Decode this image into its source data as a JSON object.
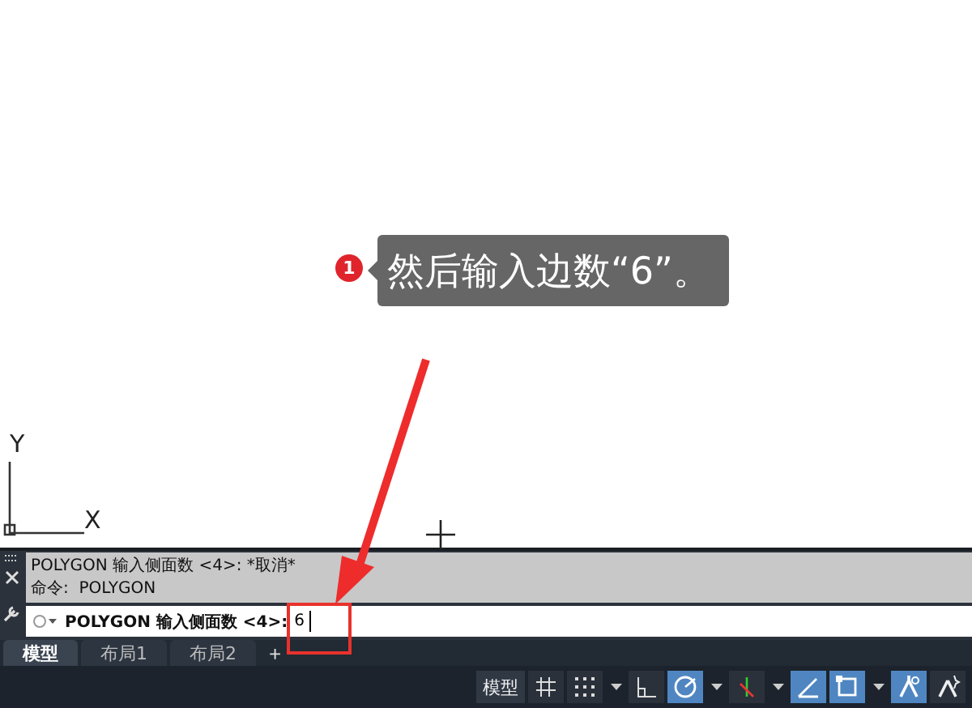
{
  "callout": {
    "badge": "1",
    "text": "然后输入边数“6”。"
  },
  "canvas": {
    "axis_y": "Y",
    "axis_x": "X"
  },
  "command": {
    "history": [
      "POLYGON 输入侧面数 <4>: *取消*",
      "命令:  POLYGON"
    ],
    "prompt": "POLYGON 输入侧面数 <4>:",
    "value": "6"
  },
  "layout_tabs": [
    {
      "label": "模型",
      "selected": true
    },
    {
      "label": "布局1",
      "selected": false
    },
    {
      "label": "布局2",
      "selected": false
    }
  ],
  "add_tab": "+",
  "status_bar": {
    "model_label": "模型",
    "toggles": [
      {
        "kind": "grid",
        "on": false
      },
      {
        "kind": "snap",
        "on": false
      },
      {
        "kind": "dropdown"
      },
      {
        "kind": "ortho",
        "on": false
      },
      {
        "kind": "polar",
        "on": true
      },
      {
        "kind": "dropdown"
      },
      {
        "kind": "tracking",
        "on": false
      },
      {
        "kind": "dropdown"
      },
      {
        "kind": "angle",
        "on": true
      },
      {
        "kind": "box",
        "on": true
      },
      {
        "kind": "dropdown"
      },
      {
        "kind": "annotate",
        "on": true
      },
      {
        "kind": "scale",
        "on": false
      }
    ]
  }
}
